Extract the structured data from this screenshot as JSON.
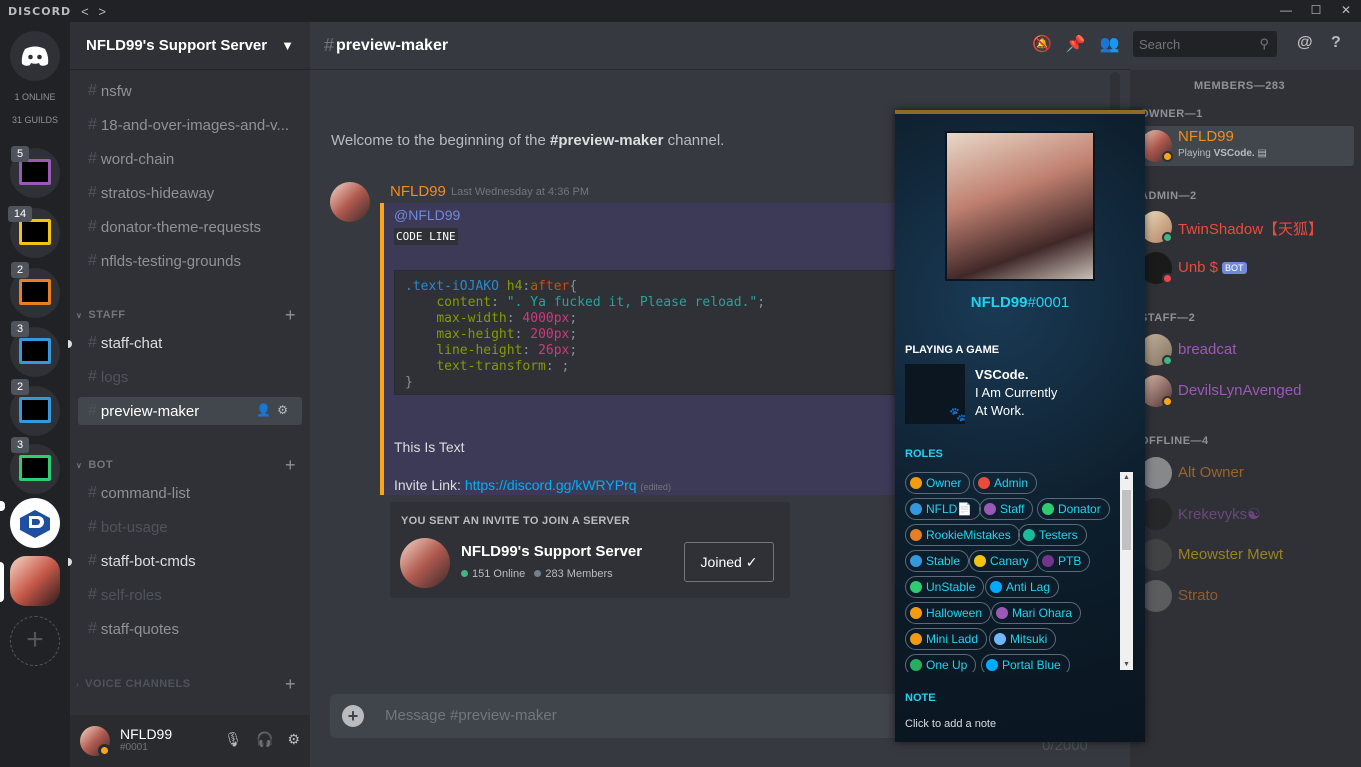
{
  "titlebar": {
    "brand": "DISCORD",
    "nav": "< >",
    "min": "—",
    "max": "☐",
    "close": "✕"
  },
  "guilds": {
    "online": "1 ONLINE",
    "count": "31 GUILDS",
    "badges": [
      "5",
      "14",
      "2",
      "3",
      "2",
      "3"
    ]
  },
  "server": {
    "name": "NFLD99's Support Server"
  },
  "channels": {
    "top": [
      "nsfw",
      "18-and-over-images-and-v...",
      "word-chain",
      "stratos-hideaway",
      "donator-theme-requests",
      "nflds-testing-grounds"
    ],
    "staff_label": "STAFF",
    "staff": [
      "staff-chat",
      "logs",
      "preview-maker"
    ],
    "bot_label": "BOT",
    "bot": [
      "command-list",
      "bot-usage",
      "staff-bot-cmds",
      "self-roles",
      "staff-quotes"
    ],
    "voice_label": "VOICE CHANNELS"
  },
  "user": {
    "name": "NFLD99",
    "tag": "#0001"
  },
  "header": {
    "channel": "preview-maker",
    "search": "Search"
  },
  "chat": {
    "welcome_pre": "Welcome to the beginning of the ",
    "welcome_channel": "#preview-maker",
    "welcome_post": " channel.",
    "author": "NFLD99",
    "time": "Last Wednesday at 4:36 PM",
    "mention": "@NFLD99",
    "inline_code": "CODE LINE",
    "text": "This Is Text",
    "invite_label": "Invite Link: ",
    "invite_url": "https://discord.gg/kWRYPrq",
    "edited": "(edited)"
  },
  "invite": {
    "label": "YOU SENT AN INVITE TO JOIN A SERVER",
    "server": "NFLD99's Support Server",
    "online": "151 Online",
    "members": "283 Members",
    "button": "Joined"
  },
  "composer": {
    "placeholder": "Message #preview-maker",
    "count": "0/2000"
  },
  "members": {
    "header": "MEMBERS—283",
    "owner_label": "OWNER—1",
    "admin_label": "ADMIN—2",
    "staff_label": "STAFF—2",
    "offline_label": "OFFLINE—4",
    "owner": {
      "name": "NFLD99",
      "playing": "Playing ",
      "game": "VSCode."
    },
    "admins": [
      "TwinShadow【天狐】",
      "Unb $"
    ],
    "bot_badge": "BOT",
    "staff": [
      "breadcat",
      "DevilsLynAvenged"
    ],
    "offline": [
      "Alt Owner",
      "Krekevyks☯",
      "Meowster Mewt",
      "Strato"
    ]
  },
  "popout": {
    "username": "NFLD99",
    "disc": "#0001",
    "playing_label": "PLAYING A GAME",
    "game_lines": [
      "VSCode.",
      "I Am Currently",
      "At Work."
    ],
    "roles_label": "ROLES",
    "roles": [
      {
        "name": "Owner",
        "color": "#f39c12"
      },
      {
        "name": "Admin",
        "color": "#e74c3c"
      },
      {
        "name": "NFLD📄",
        "color": "#3498db"
      },
      {
        "name": "Staff",
        "color": "#9b59b6"
      },
      {
        "name": "Donator",
        "color": "#2ecc71"
      },
      {
        "name": "RookieMistakes",
        "color": "#e67e22"
      },
      {
        "name": "Testers",
        "color": "#1abc9c"
      },
      {
        "name": "Stable",
        "color": "#3498db"
      },
      {
        "name": "Canary",
        "color": "#f1c40f"
      },
      {
        "name": "PTB",
        "color": "#71368a"
      },
      {
        "name": "UnStable",
        "color": "#2ecc71"
      },
      {
        "name": "Anti Lag",
        "color": "#00aaff"
      },
      {
        "name": "Halloween",
        "color": "#f39c12"
      },
      {
        "name": "Mari Ohara",
        "color": "#9b59b6"
      },
      {
        "name": "Mini Ladd",
        "color": "#f39c12"
      },
      {
        "name": "Mitsuki",
        "color": "#6fb8ff"
      },
      {
        "name": "One Up",
        "color": "#27ae60"
      },
      {
        "name": "Portal Blue",
        "color": "#00aaff"
      }
    ],
    "note_label": "NOTE",
    "note_placeholder": "Click to add a note"
  }
}
